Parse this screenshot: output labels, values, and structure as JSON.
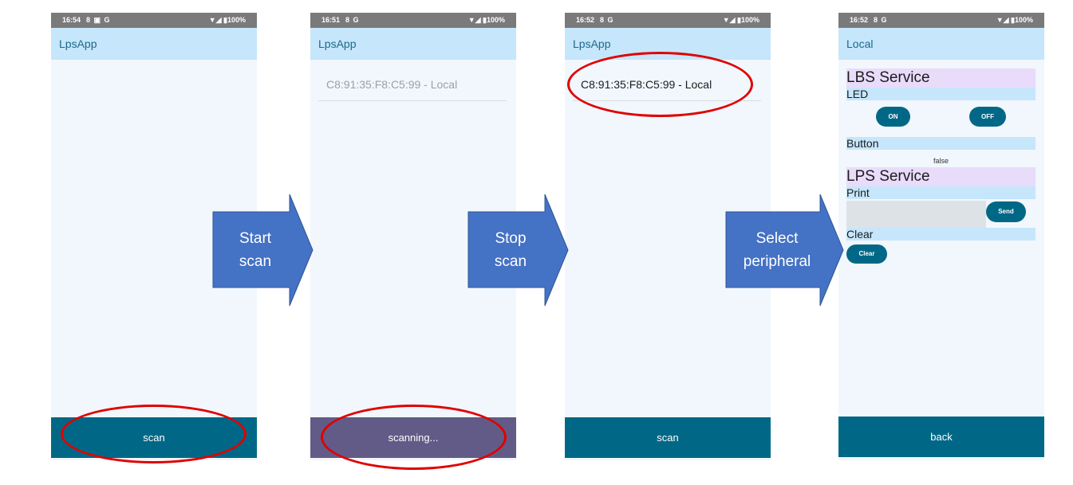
{
  "statusbar": {
    "p1": {
      "time": "16:54",
      "icons": "8 ▣ G",
      "right": "▼◢ ▮100%"
    },
    "p2": {
      "time": "16:51",
      "icons": "8 G",
      "right": "▼◢ ▮100%"
    },
    "p3": {
      "time": "16:52",
      "icons": "8 G",
      "right": "▼◢ ▮100%"
    },
    "p4": {
      "time": "16:52",
      "icons": "8 G",
      "right": "▼◢ ▮100%"
    }
  },
  "phones": {
    "p1": {
      "title": "LpsApp",
      "bottom_button": "scan"
    },
    "p2": {
      "title": "LpsApp",
      "device": "C8:91:35:F8:C5:99 - Local",
      "bottom_button": "scanning..."
    },
    "p3": {
      "title": "LpsApp",
      "device": "C8:91:35:F8:C5:99 - Local",
      "bottom_button": "scan"
    },
    "p4": {
      "title": "Local",
      "lbs_title": "LBS Service",
      "led_label": "LED",
      "on_label": "ON",
      "off_label": "OFF",
      "button_label": "Button",
      "button_value": "false",
      "lps_title": "LPS Service",
      "print_label": "Print",
      "send_label": "Send",
      "clear_section_label": "Clear",
      "clear_button": "Clear",
      "bottom_button": "back"
    }
  },
  "arrows": {
    "a1": {
      "line1": "Start",
      "line2": "scan"
    },
    "a2": {
      "line1": "Stop",
      "line2": "scan"
    },
    "a3": {
      "line1": "Select",
      "line2": "peripheral"
    }
  },
  "colors": {
    "arrow_fill": "#4472c4",
    "highlight": "#e00000",
    "primary": "#006886",
    "scanning": "#625b87"
  }
}
